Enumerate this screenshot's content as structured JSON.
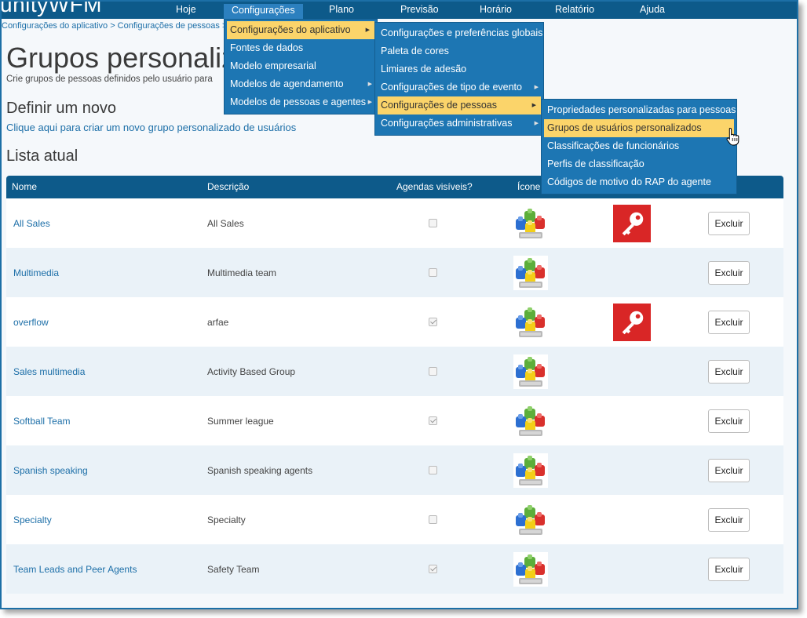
{
  "brand": "unityWFM",
  "nav": [
    {
      "label": "Hoje"
    },
    {
      "label": "Configurações"
    },
    {
      "label": "Plano"
    },
    {
      "label": "Previsão"
    },
    {
      "label": "Horário"
    },
    {
      "label": "Relatório"
    },
    {
      "label": "Ajuda"
    }
  ],
  "breadcrumb": "Configurações do aplicativo > Configurações de pessoas > C",
  "page": {
    "title": "Grupos personalizados de usuários",
    "subtitle": "Crie grupos de pessoas definidos pelo usuário para",
    "define_title": "Definir um novo",
    "create_link": "Clique aqui para criar um novo grupo personalizado de usuários",
    "list_title": "Lista atual"
  },
  "table": {
    "headers": {
      "name": "Nome",
      "description": "Descrição",
      "schedules_visible": "Agendas visíveis?",
      "icon": "Ícone"
    },
    "delete_label": "Excluir",
    "rows": [
      {
        "name": "All Sales",
        "description": "All Sales",
        "schedules_visible": false,
        "has_key": true
      },
      {
        "name": "Multimedia",
        "description": "Multimedia team",
        "schedules_visible": false,
        "has_key": false
      },
      {
        "name": "overflow",
        "description": "arfae",
        "schedules_visible": true,
        "has_key": true
      },
      {
        "name": "Sales multimedia",
        "description": "Activity Based Group",
        "schedules_visible": false,
        "has_key": false
      },
      {
        "name": "Softball Team",
        "description": "Summer league",
        "schedules_visible": true,
        "has_key": false
      },
      {
        "name": "Spanish speaking",
        "description": "Spanish speaking agents",
        "schedules_visible": false,
        "has_key": false
      },
      {
        "name": "Specialty",
        "description": "Specialty",
        "schedules_visible": false,
        "has_key": false
      },
      {
        "name": "Team Leads and Peer Agents",
        "description": "Safety Team",
        "schedules_visible": true,
        "has_key": false
      }
    ]
  },
  "menus": {
    "config": [
      {
        "label": "Configurações do aplicativo",
        "submenu": true,
        "highlighted": true
      },
      {
        "label": "Fontes de dados",
        "submenu": false
      },
      {
        "label": "Modelo empresarial",
        "submenu": false
      },
      {
        "label": "Modelos de agendamento",
        "submenu": true
      },
      {
        "label": "Modelos de pessoas e agentes",
        "submenu": true
      }
    ],
    "app_settings": [
      {
        "label": "Configurações e preferências globais",
        "submenu": false
      },
      {
        "label": "Paleta de cores",
        "submenu": false
      },
      {
        "label": "Limiares de adesão",
        "submenu": false
      },
      {
        "label": "Configurações de tipo de evento",
        "submenu": true
      },
      {
        "label": "Configurações de pessoas",
        "submenu": true,
        "highlighted": true
      },
      {
        "label": "Configurações administrativas",
        "submenu": true
      }
    ],
    "people_settings": [
      {
        "label": "Propriedades personalizadas para pessoas",
        "submenu": false
      },
      {
        "label": "Grupos de usuários personalizados",
        "submenu": false,
        "highlighted": true
      },
      {
        "label": "Classificações de funcionários",
        "submenu": false
      },
      {
        "label": "Perfis de classificação",
        "submenu": false
      },
      {
        "label": "Códigos de motivo do RAP do agente",
        "submenu": false
      }
    ]
  },
  "colors": {
    "topbar": "#0d5a8a",
    "menu": "#1d76b3",
    "highlight": "#fbd46a",
    "link": "#1d6fa8",
    "key_bg": "#d92626"
  }
}
